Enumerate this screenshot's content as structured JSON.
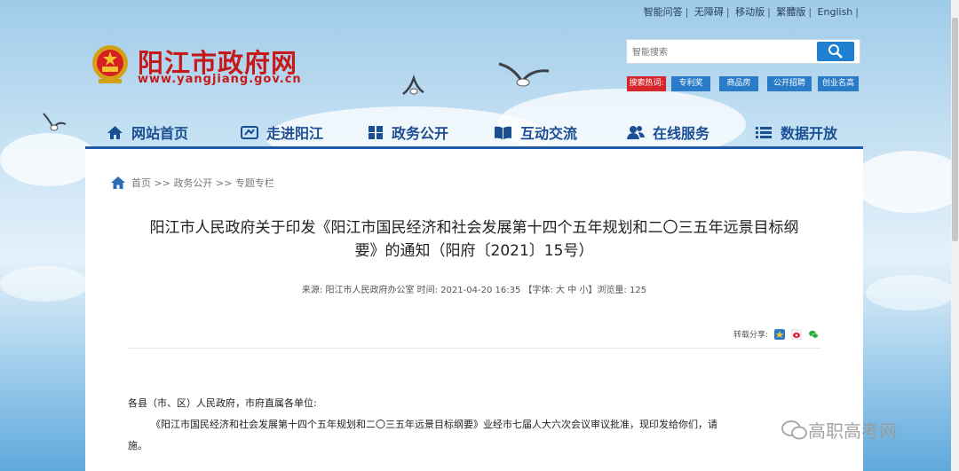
{
  "top_links": [
    "智能问答",
    "无障碍",
    "移动版",
    "繁體版",
    "English"
  ],
  "site": {
    "title": "阳江市政府网",
    "url": "www.yangjiang.gov.cn"
  },
  "search": {
    "placeholder": "智能搜索",
    "hot_label": "搜索热词:",
    "hot_tags": [
      "专利奖",
      "商品房",
      "公开招聘",
      "创业名高"
    ]
  },
  "nav": [
    "网站首页",
    "走进阳江",
    "政务公开",
    "互动交流",
    "在线服务",
    "数据开放"
  ],
  "breadcrumb": {
    "home": "首页",
    "sep1": ">>",
    "level1": "政务公开",
    "sep2": ">>",
    "level2": "专题专栏"
  },
  "article": {
    "title_line1": "阳江市人民政府关于印发《阳江市国民经济和社会发展第十四个五年规划和二〇三五年远景目标纲",
    "title_line2": "要》的通知（阳府〔2021〕15号）",
    "meta_source": "来源:  阳江市人民政府办公室 时间: 2021-04-20 16:35 【字体:",
    "font_sizes": [
      "大",
      "中",
      "小"
    ],
    "meta_views": "】浏览量: 125",
    "share_label": "转载分享:",
    "greeting": "各县（市、区）人民政府，市府直属各单位:",
    "body_line1": "《阳江市国民经济和社会发展第十四个五年规划和二〇三五年远景目标纲要》业经市七届人大六次会议审议批准，现印发给你们，请",
    "body_line2": "施。"
  },
  "watermark": "高职高考网",
  "colors": {
    "brand_red": "#c61a1a",
    "nav_blue": "#1b4f94",
    "hot_red": "#d6262b",
    "tag_blue": "#2b7cc8"
  }
}
